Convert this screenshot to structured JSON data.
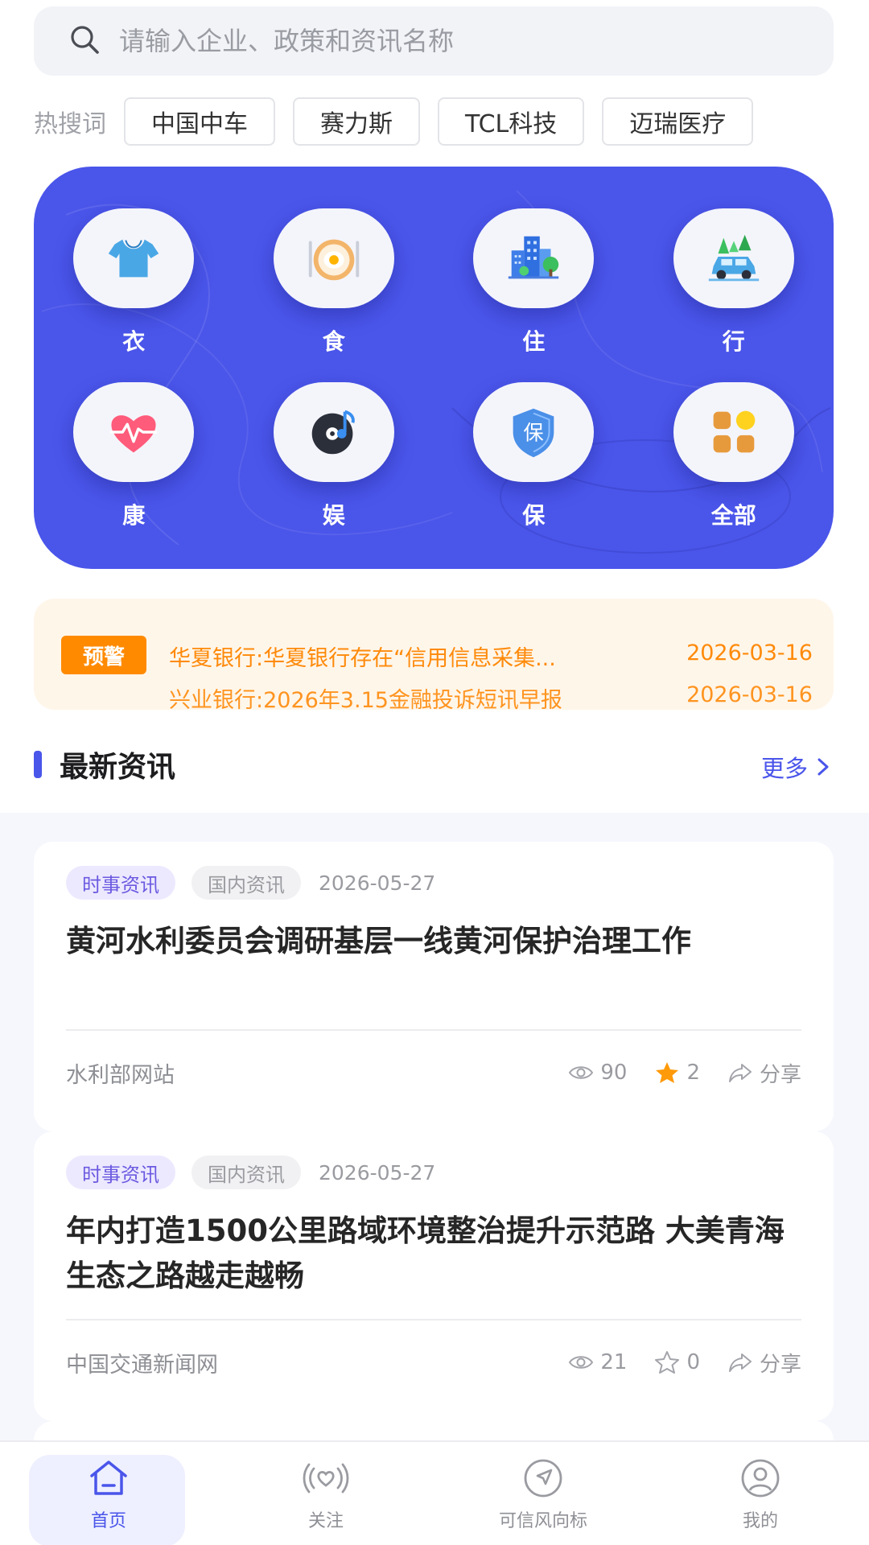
{
  "search": {
    "placeholder": "请输入企业、政策和资讯名称"
  },
  "hot": {
    "label": "热搜词",
    "tags": [
      "中国中车",
      "赛力斯",
      "TCL科技",
      "迈瑞医疗"
    ]
  },
  "categories": [
    {
      "label": "衣",
      "icon": "tshirt-icon"
    },
    {
      "label": "食",
      "icon": "food-plate-icon"
    },
    {
      "label": "住",
      "icon": "building-icon"
    },
    {
      "label": "行",
      "icon": "car-icon"
    },
    {
      "label": "康",
      "icon": "heart-pulse-icon"
    },
    {
      "label": "娱",
      "icon": "music-disc-icon"
    },
    {
      "label": "保",
      "icon": "shield-icon"
    },
    {
      "label": "全部",
      "icon": "grid-all-icon"
    }
  ],
  "warning": {
    "badge": "预警",
    "items": [
      {
        "title": "华夏银行:华夏银行存在“信用信息采集...",
        "date": "2026-03-16"
      },
      {
        "title": "兴业银行:2026年3.15金融投诉短讯早报",
        "date": "2026-03-16"
      }
    ]
  },
  "news_section": {
    "title": "最新资讯",
    "more": "更多"
  },
  "news": [
    {
      "tag1": "时事资讯",
      "tag2": "国内资讯",
      "date": "2026-05-27",
      "title": "黄河水利委员会调研基层一线黄河保护治理工作",
      "source": "水利部网站",
      "views": "90",
      "stars": "2",
      "starred": true,
      "share": "分享"
    },
    {
      "tag1": "时事资讯",
      "tag2": "国内资讯",
      "date": "2026-05-27",
      "title": "年内打造1500公里路域环境整治提升示范路 大美青海生态之路越走越畅",
      "source": "中国交通新闻网",
      "views": "21",
      "stars": "0",
      "starred": false,
      "share": "分享"
    }
  ],
  "tabs": [
    {
      "label": "首页",
      "icon": "home-icon",
      "active": true
    },
    {
      "label": "关注",
      "icon": "broadcast-heart-icon",
      "active": false
    },
    {
      "label": "可信风向标",
      "icon": "compass-icon",
      "active": false
    },
    {
      "label": "我的",
      "icon": "user-icon",
      "active": false
    }
  ],
  "colors": {
    "accent": "#4a55ea",
    "warning": "#ff8a00",
    "star": "#ff9a0a"
  }
}
